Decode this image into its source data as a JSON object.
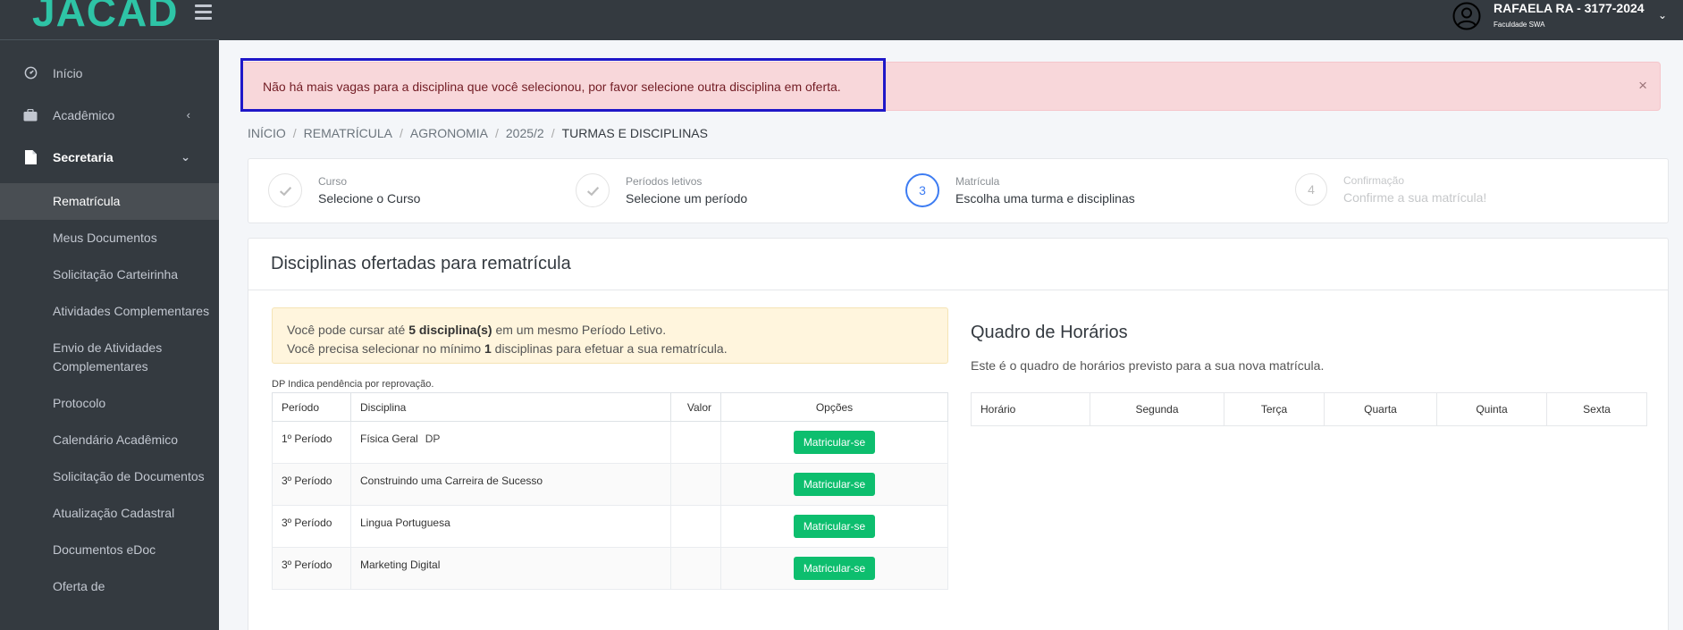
{
  "brand": {
    "logo_text": "JACAD"
  },
  "sidebar": {
    "items": [
      {
        "label": "Início"
      },
      {
        "label": "Acadêmico"
      },
      {
        "label": "Secretaria"
      }
    ],
    "submenu": [
      "Rematrícula",
      "Meus Documentos",
      "Solicitação Carteirinha",
      "Atividades Complementares",
      "Envio de Atividades Complementares",
      "Protocolo",
      "Calendário Acadêmico",
      "Solicitação de Documentos",
      "Atualização Cadastral",
      "Documentos eDoc",
      "Oferta de"
    ]
  },
  "user": {
    "name": "RAFAELA RA - 3177-2024",
    "institution": "Faculdade SWA"
  },
  "alert": {
    "message": "Não há mais vagas para a disciplina que você selecionou, por favor selecione outra disciplina em oferta.",
    "close": "×"
  },
  "breadcrumb": [
    "INÍCIO",
    "REMATRÍCULA",
    "AGRONOMIA",
    "2025/2",
    "TURMAS E DISCIPLINAS"
  ],
  "steps": [
    {
      "label": "Curso",
      "title": "Selecione o Curso",
      "state": "done",
      "number": ""
    },
    {
      "label": "Períodos letivos",
      "title": "Selecione um período",
      "state": "done",
      "number": ""
    },
    {
      "label": "Matrícula",
      "title": "Escolha uma turma e disciplinas",
      "state": "current",
      "number": "3"
    },
    {
      "label": "Confirmação",
      "title": "Confirme a sua matrícula!",
      "state": "pending",
      "number": "4"
    }
  ],
  "card": {
    "title": "Disciplinas ofertadas para rematrícula"
  },
  "info": {
    "line1_pre": "Você pode cursar até ",
    "line1_bold": "5 disciplina(s)",
    "line1_post": " em um mesmo Período Letivo.",
    "line2_pre": "Você precisa selecionar no mínimo ",
    "line2_bold": "1",
    "line2_post": " disciplinas para efetuar a sua rematrícula."
  },
  "dp_note": "DP Indica pendência por reprovação.",
  "table": {
    "headers": {
      "period": "Período",
      "discipline": "Disciplina",
      "value": "Valor",
      "options": "Opções"
    },
    "rows": [
      {
        "period": "1º Período",
        "discipline": "Física Geral",
        "tag": "DP",
        "value": "",
        "action": "Matricular-se"
      },
      {
        "period": "3º Período",
        "discipline": "Construindo uma Carreira de Sucesso",
        "tag": "",
        "value": "",
        "action": "Matricular-se"
      },
      {
        "period": "3º Período",
        "discipline": "Lingua Portuguesa",
        "tag": "",
        "value": "",
        "action": "Matricular-se"
      },
      {
        "period": "3º Período",
        "discipline": "Marketing Digital",
        "tag": "",
        "value": "",
        "action": "Matricular-se"
      }
    ]
  },
  "schedule": {
    "title": "Quadro de Horários",
    "subtitle": "Este é o quadro de horários previsto para a sua nova matrícula.",
    "headers": [
      "Horário",
      "Segunda",
      "Terça",
      "Quarta",
      "Quinta",
      "Sexta"
    ]
  },
  "colors": {
    "sidebar": "#343a40",
    "accent_green": "#0dbe6e",
    "alert_bg": "#f8d7da",
    "step_current": "#3d7cf2",
    "brand": "#2ec4a6"
  }
}
